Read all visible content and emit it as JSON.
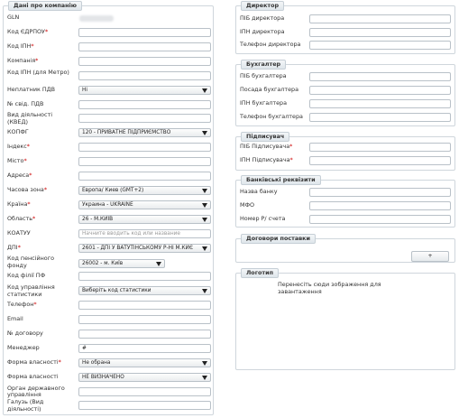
{
  "company": {
    "legend": "Дані про компанію",
    "gln_label": "GLN",
    "fields": [
      {
        "label": "Код ЄДРПОУ",
        "required": true,
        "type": "text",
        "value": ""
      },
      {
        "label": "Код ІПН",
        "required": true,
        "type": "text",
        "value": ""
      },
      {
        "label": "Компанія",
        "required": true,
        "type": "text",
        "value": ""
      },
      {
        "label": "Код ІПН (для Метро)",
        "required": false,
        "type": "text",
        "value": ""
      },
      {
        "label": "Неплатник ПДВ",
        "required": false,
        "type": "select",
        "value": "Ні"
      },
      {
        "label": "№ свід. ПДВ",
        "required": false,
        "type": "text",
        "value": ""
      },
      {
        "label": "Вид діяльності (КВЕД)",
        "required": false,
        "type": "text",
        "value": ""
      },
      {
        "label": "КОПФГ",
        "required": false,
        "type": "select",
        "value": "120 - ПРИВАТНЕ ПІДПРИЄМСТВО"
      },
      {
        "label": "Індекс",
        "required": true,
        "type": "text",
        "value": ""
      },
      {
        "label": "Місто",
        "required": true,
        "type": "text",
        "value": ""
      },
      {
        "label": "Адреса",
        "required": true,
        "type": "text",
        "value": ""
      },
      {
        "label": "Часова зона",
        "required": true,
        "type": "select",
        "value": "Европа/ Киев (GMT+2)"
      },
      {
        "label": "Країна",
        "required": true,
        "type": "select",
        "value": "Украина - UKRAINE"
      },
      {
        "label": "Область",
        "required": true,
        "type": "select",
        "value": "26 - М.КИЇВ"
      },
      {
        "label": "КОАТУУ",
        "required": false,
        "type": "text",
        "value": "",
        "placeholder": "Начните вводить код или название"
      },
      {
        "label": "ДПІ",
        "required": true,
        "type": "select",
        "value": "2601 - ДПІ У ВАТУТІНСЬКОМУ Р-НІ М.КИЄ"
      },
      {
        "label": "Код пенсійного фонду",
        "required": false,
        "type": "select",
        "value": "26002 - м. Київ",
        "narrow": true
      },
      {
        "label": "Код філії ПФ",
        "required": false,
        "type": "text",
        "value": ""
      },
      {
        "label": "Код управління статистики",
        "required": false,
        "type": "select",
        "value": "Виберіть код статистики"
      },
      {
        "label": "Телефон",
        "required": true,
        "type": "text",
        "value": ""
      },
      {
        "label": "Email",
        "required": false,
        "type": "text",
        "value": ""
      },
      {
        "label": "№ договору",
        "required": false,
        "type": "text",
        "value": ""
      },
      {
        "label": "Менеджер",
        "required": false,
        "type": "text",
        "value": "#"
      },
      {
        "label": "Форма власності",
        "required": true,
        "type": "select",
        "value": "Не обрана"
      },
      {
        "label": "Форма власності",
        "required": false,
        "type": "select",
        "value": "НЕ ВИЗНАЧЕНО"
      },
      {
        "label": "Орган державного управління",
        "required": false,
        "type": "text",
        "value": ""
      },
      {
        "label": "Галузь (Вид діяльності)",
        "required": false,
        "type": "text",
        "value": ""
      }
    ]
  },
  "director": {
    "legend": "Директор",
    "fields": [
      {
        "label": "ПІБ директора",
        "required": false,
        "value": ""
      },
      {
        "label": "ІПН директора",
        "required": false,
        "value": ""
      },
      {
        "label": "Телефон директора",
        "required": false,
        "value": ""
      }
    ]
  },
  "accountant": {
    "legend": "Бухгалтер",
    "fields": [
      {
        "label": "ПІБ бухгалтера",
        "required": false,
        "value": ""
      },
      {
        "label": "Посада бухгалтера",
        "required": false,
        "value": ""
      },
      {
        "label": "ІПН бухгалтера",
        "required": false,
        "value": ""
      },
      {
        "label": "Телефон бухгалтера",
        "required": false,
        "value": ""
      }
    ]
  },
  "signer": {
    "legend": "Підписувач",
    "fields": [
      {
        "label": "ПІБ Підписувача",
        "required": true,
        "value": ""
      },
      {
        "label": "ІПН Підписувача",
        "required": true,
        "value": ""
      }
    ]
  },
  "bank": {
    "legend": "Банківські реквізити",
    "fields": [
      {
        "label": "Назва банку",
        "required": false,
        "value": ""
      },
      {
        "label": "МФО",
        "required": false,
        "value": ""
      },
      {
        "label": "Номер Р/ счета",
        "required": false,
        "value": ""
      }
    ]
  },
  "contracts": {
    "legend": "Договори поставки",
    "add_label": "+"
  },
  "logo": {
    "legend": "Логотип",
    "drop_text": "Перенесіть сюди зображення для завантаження"
  },
  "colors": {
    "required_mark": "#cc0000",
    "border": "#b9c1c8"
  }
}
